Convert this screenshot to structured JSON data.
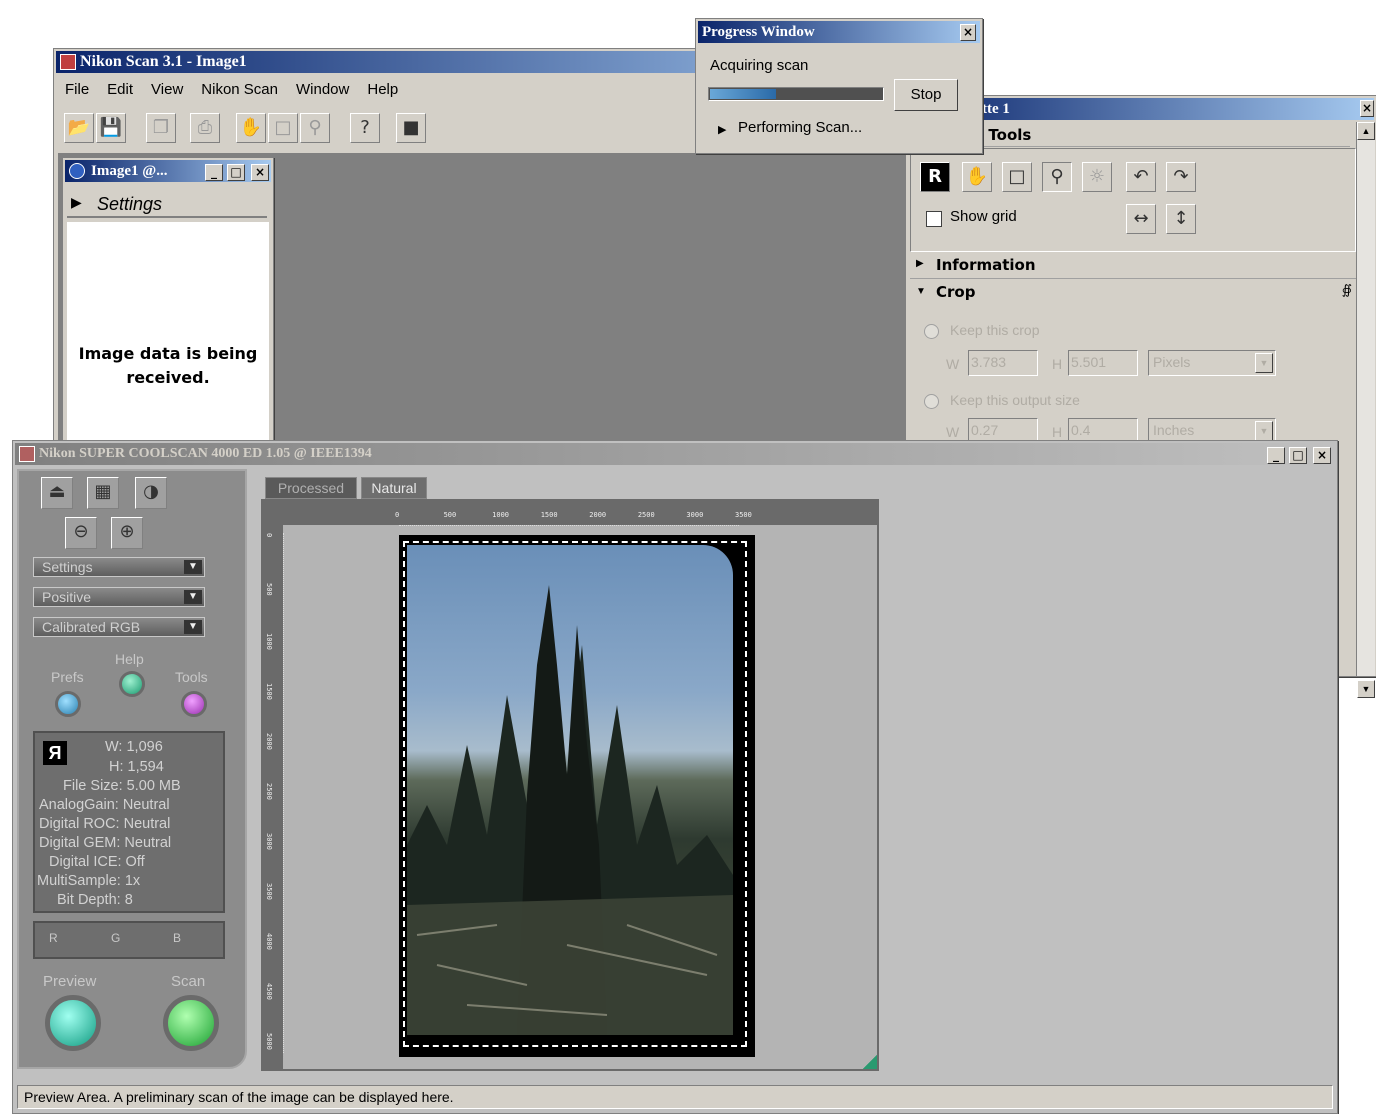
{
  "main_window": {
    "title": "Nikon Scan 3.1 - Image1",
    "menu": [
      "File",
      "Edit",
      "View",
      "Nikon Scan",
      "Window",
      "Help"
    ]
  },
  "image_window": {
    "title": "Image1 @...",
    "settings_label": "Settings",
    "message_line1": "Image data is being",
    "message_line2": "received."
  },
  "progress_window": {
    "title": "Progress Window",
    "status": "Acquiring scan",
    "progress_fraction": 0.38,
    "stop_label": "Stop",
    "detail": "Performing Scan..."
  },
  "tool_palette": {
    "title": "tte 1",
    "section_tools": "t Tools",
    "show_grid_label": "Show grid",
    "information_label": "Information",
    "crop_label": "Crop",
    "keep_crop_label": "Keep this crop",
    "w_label": "W",
    "h_label": "H",
    "crop_w": "3.783",
    "crop_h": "5.501",
    "crop_unit": "Pixels",
    "keep_output_label": "Keep this output size",
    "out_w": "0.27",
    "out_h": "0.4",
    "out_unit": "Inches"
  },
  "scanner_window": {
    "title": "Nikon SUPER COOLSCAN 4000 ED 1.05 @ IEEE1394",
    "tab_processed": "Processed",
    "tab_natural": "Natural",
    "combo_settings": "Settings",
    "combo_positive": "Positive",
    "combo_color": "Calibrated RGB",
    "help_label": "Help",
    "prefs_label": "Prefs",
    "tools_label": "Tools",
    "info": {
      "w": "W: 1,096",
      "h": "H: 1,594",
      "file_size": "File Size: 5.00 MB",
      "analog_gain": "AnalogGain: Neutral",
      "digital_roc": "Digital ROC: Neutral",
      "digital_gem": "Digital GEM: Neutral",
      "digital_ice": "Digital ICE: Off",
      "multisample": "MultiSample: 1x",
      "bit_depth": "Bit Depth: 8"
    },
    "rgb": [
      "R",
      "G",
      "B"
    ],
    "preview_label": "Preview",
    "scan_label": "Scan",
    "ruler_top": [
      "0",
      "500",
      "1000",
      "1500",
      "2000",
      "2500",
      "3000",
      "3500"
    ],
    "ruler_left": [
      "0",
      "500",
      "1000",
      "1500",
      "2000",
      "2500",
      "3000",
      "3500",
      "4000",
      "4500",
      "5000"
    ],
    "status_bar": "Preview Area. A preliminary scan of the image can be displayed here."
  },
  "colors": {
    "titlebar_active": "#0a246a",
    "dialog_face": "#d4d0c8",
    "workspace": "#808080",
    "scanner_panel": "#8c8c8c",
    "preview_bg": "#c0c0c0"
  }
}
